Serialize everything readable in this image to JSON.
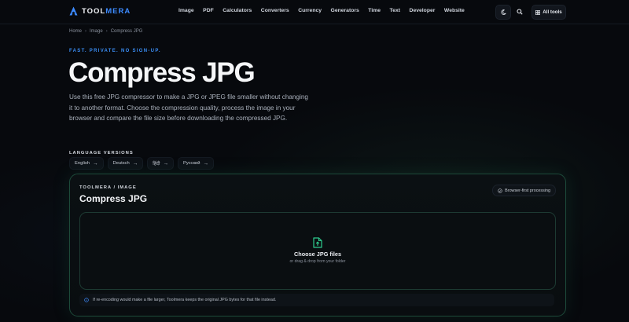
{
  "header": {
    "logo_prefix": "TOOL",
    "logo_suffix": "MERA",
    "nav": [
      "Image",
      "PDF",
      "Calculators",
      "Converters",
      "Currency",
      "Generators",
      "Time",
      "Text",
      "Developer",
      "Website"
    ],
    "all_tools_label": "All tools",
    "theme_icon": "moon-icon",
    "search_icon": "search-icon",
    "grid_icon": "grid-icon"
  },
  "breadcrumb": [
    "Home",
    "Image",
    "Compress JPG"
  ],
  "hero": {
    "eyebrow": "FAST. PRIVATE. NO SIGN-UP.",
    "title": "Compress JPG",
    "description": "Use this free JPG compressor to make a JPG or JPEG file smaller without changing it to another format. Choose the compression quality, process the image in your browser and compare the file size before downloading the compressed JPG."
  },
  "languages": {
    "label": "LANGUAGE VERSIONS",
    "items": [
      "English",
      "Deutsch",
      "हिंदी",
      "Русский"
    ]
  },
  "tool": {
    "eyebrow": "TOOLMERA / IMAGE",
    "title": "Compress JPG",
    "badge": "Browser-first processing",
    "dropzone_title": "Choose JPG files",
    "dropzone_subtitle": "or drag & drop from your folder",
    "note": "If re-encoding would make a file larger, Toolmera keeps the original JPG bytes for that file instead."
  },
  "colors": {
    "accent": "#3d8bff",
    "green_accent": "#2ecc8f",
    "background": "#07090d"
  }
}
